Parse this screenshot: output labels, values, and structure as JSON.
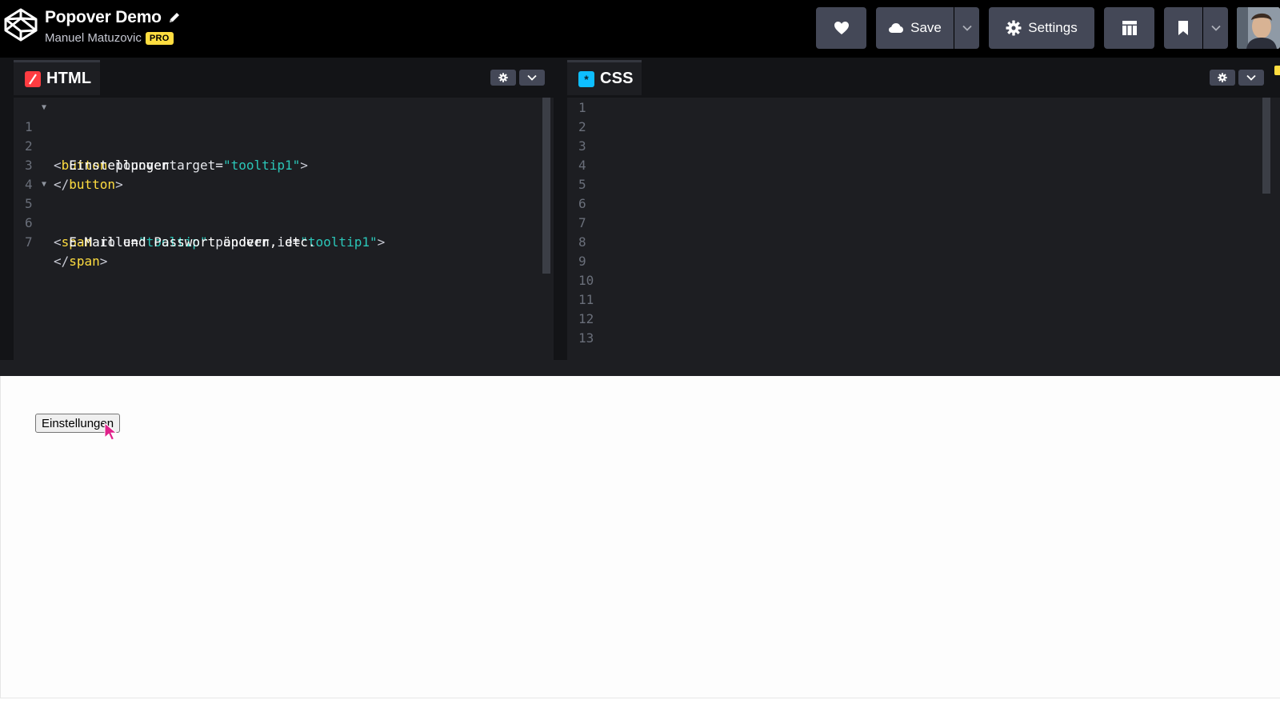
{
  "header": {
    "title": "Popover Demo",
    "author": "Manuel Matuzovic",
    "badge": "PRO",
    "save_label": "Save",
    "settings_label": "Settings"
  },
  "html_pane": {
    "label": "HTML",
    "lines": [
      {
        "num": "1"
      },
      {
        "num": "2",
        "text": "  Einstellungen"
      },
      {
        "num": "3"
      },
      {
        "num": "4",
        "text": ""
      },
      {
        "num": "5"
      },
      {
        "num": "6",
        "text": "  E-Mail und Passwort ändern, etc."
      },
      {
        "num": "7"
      }
    ],
    "tokens": {
      "l1": [
        "<",
        "button",
        " popovertarget=",
        "\"tooltip1\"",
        ">"
      ],
      "l3": [
        "</",
        "button",
        ">"
      ],
      "l5": [
        "<",
        "span",
        " role=",
        "\"tooltip\"",
        " popover id=",
        "\"tooltip1\"",
        ">"
      ],
      "l7": [
        "</",
        "span",
        ">"
      ]
    }
  },
  "css_pane": {
    "label": "CSS",
    "line_numbers": [
      "1",
      "2",
      "3",
      "4",
      "5",
      "6",
      "7",
      "8",
      "9",
      "10",
      "11",
      "12",
      "13"
    ]
  },
  "preview": {
    "button_label": "Einstellungen"
  },
  "icons": {
    "logo": "codepen-logo-icon",
    "heart": "heart-icon",
    "save": "cloud-icon",
    "settings": "gear-icon",
    "layout": "layout-grid-icon",
    "bookmark": "bookmark-icon"
  },
  "colors": {
    "topbar": "#000000",
    "editor_bg": "#1d1e22",
    "button_bg": "#444857",
    "pro_badge": "#ffdd40",
    "tag": "#ffdd40",
    "string": "#2bc7b9",
    "html_icon": "#ff3c41",
    "css_icon": "#0ebeff",
    "cursor": "#e0218a"
  }
}
